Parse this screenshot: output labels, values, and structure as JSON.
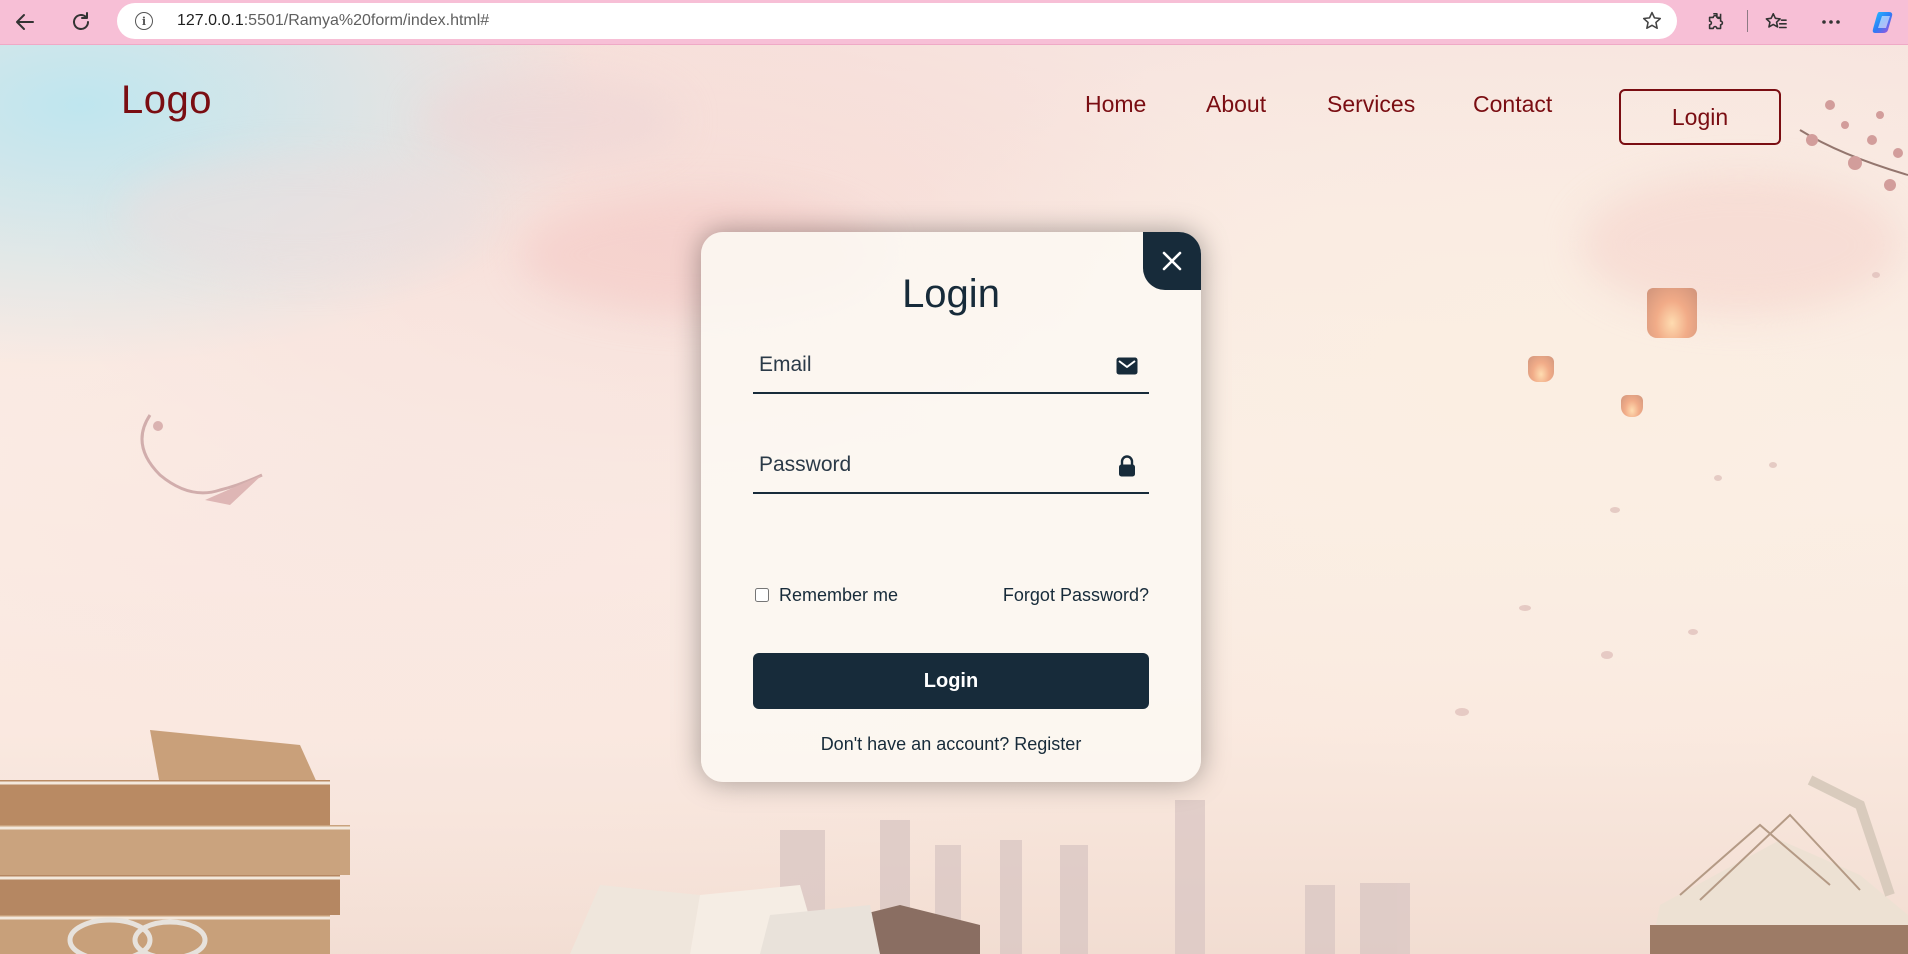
{
  "browser": {
    "url_host": "127.0.0.1",
    "url_path": ":5501/Ramya%20form/index.html#",
    "icons": [
      "back-arrow-icon",
      "refresh-icon",
      "info-icon",
      "star-icon",
      "extensions-icon",
      "favorites-icon",
      "more-icon",
      "copilot-icon"
    ]
  },
  "header": {
    "logo": "Logo",
    "nav": [
      "Home",
      "About",
      "Services",
      "Contact"
    ],
    "login_button": "Login"
  },
  "login_form": {
    "title": "Login",
    "email_placeholder": "Email",
    "password_placeholder": "Password",
    "remember_label": "Remember me",
    "forgot_link": "Forgot Password?",
    "submit_label": "Login",
    "register_prompt": "Don't have an account?",
    "register_link": "Register",
    "icons": [
      "close-icon",
      "mail-icon",
      "lock-icon"
    ]
  },
  "colors": {
    "brand_maroon": "#7a0d12",
    "dark_navy": "#172b3a",
    "browser_bar": "#f7bfd6"
  }
}
